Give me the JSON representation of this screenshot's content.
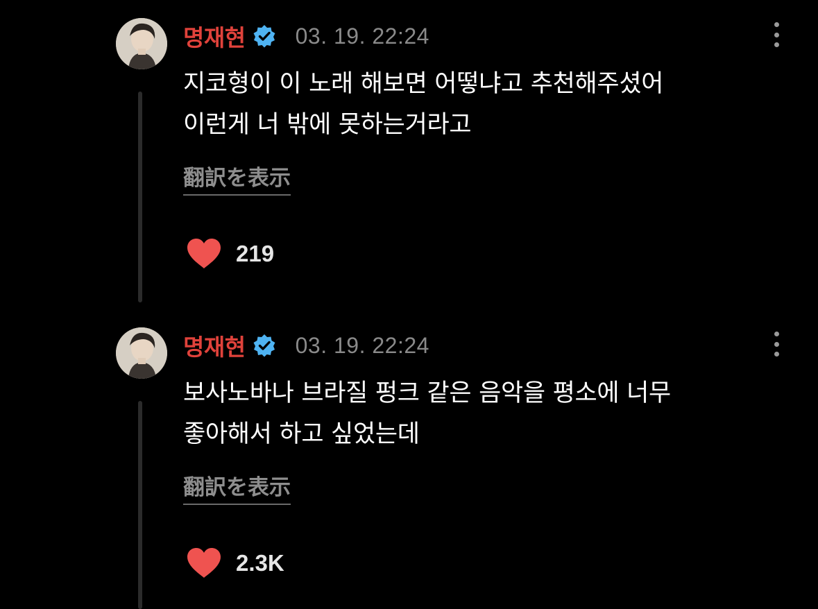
{
  "colors": {
    "background": "#000000",
    "username": "#e0423b",
    "verified_badge": "#4fb3f2",
    "timestamp": "#8a8a8a",
    "heart": "#ef5350",
    "thread_line": "#2b2b2b"
  },
  "comments": [
    {
      "username": "명재현",
      "verified_icon": "verified-badge-icon",
      "timestamp": "03. 19. 22:24",
      "text_lines": [
        "지코형이 이 노래 해보면 어떻냐고 추천해주셨어",
        "이런게 너 밖에 못하는거라고"
      ],
      "translate_label": "翻訳を表示",
      "like_icon": "heart-icon",
      "like_count": "219"
    },
    {
      "username": "명재현",
      "verified_icon": "verified-badge-icon",
      "timestamp": "03. 19. 22:24",
      "text_lines": [
        "보사노바나 브라질 펑크 같은 음악을 평소에 너무",
        "좋아해서 하고 싶었는데"
      ],
      "translate_label": "翻訳を表示",
      "like_icon": "heart-icon",
      "like_count": "2.3K"
    }
  ]
}
